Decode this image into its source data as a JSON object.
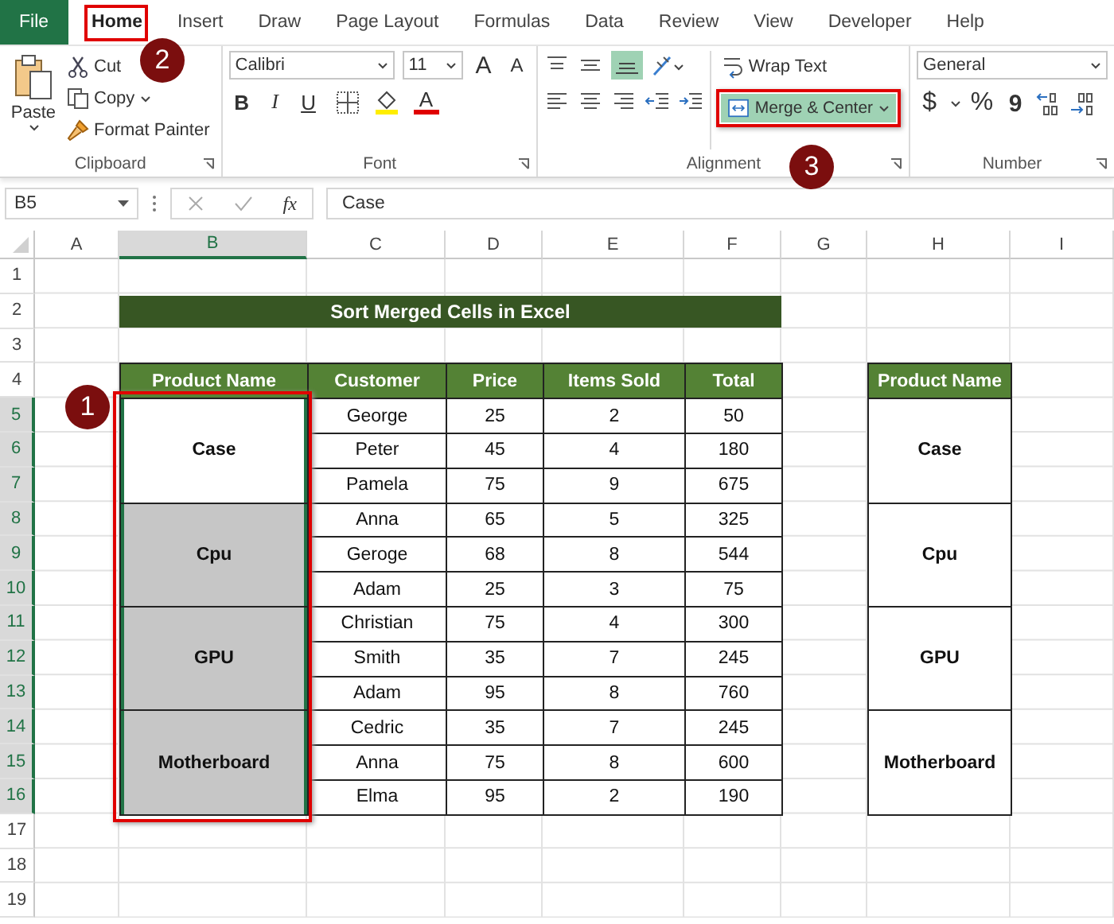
{
  "tabs": [
    {
      "label": "File",
      "kind": "file",
      "selected": false
    },
    {
      "label": "Home",
      "kind": "tab",
      "selected": true
    },
    {
      "label": "Insert",
      "kind": "tab",
      "selected": false
    },
    {
      "label": "Draw",
      "kind": "tab",
      "selected": false
    },
    {
      "label": "Page Layout",
      "kind": "tab",
      "selected": false
    },
    {
      "label": "Formulas",
      "kind": "tab",
      "selected": false
    },
    {
      "label": "Data",
      "kind": "tab",
      "selected": false
    },
    {
      "label": "Review",
      "kind": "tab",
      "selected": false
    },
    {
      "label": "View",
      "kind": "tab",
      "selected": false
    },
    {
      "label": "Developer",
      "kind": "tab",
      "selected": false
    },
    {
      "label": "Help",
      "kind": "tab",
      "selected": false
    }
  ],
  "clipboard": {
    "paste": "Paste",
    "cut": "Cut",
    "copy": "Copy",
    "format_painter": "Format Painter",
    "label": "Clipboard"
  },
  "font": {
    "name": "Calibri",
    "size": "11",
    "grow": "A",
    "shrink": "A",
    "bold": "B",
    "italic": "I",
    "underline": "U",
    "color_button": "A",
    "label": "Font"
  },
  "alignment": {
    "wrap_text": "Wrap Text",
    "merge_center": {
      "label": "Merge & Center",
      "selected": true
    },
    "label": "Alignment"
  },
  "number": {
    "format": "General",
    "currency": "$",
    "percent": "%",
    "comma": "9",
    "label": "Number"
  },
  "formula_bar": {
    "name_box": "B5",
    "fx": "fx",
    "formula": "Case"
  },
  "columns": [
    {
      "label": "A",
      "selected": false
    },
    {
      "label": "B",
      "selected": true
    },
    {
      "label": "C",
      "selected": false
    },
    {
      "label": "D",
      "selected": false
    },
    {
      "label": "E",
      "selected": false
    },
    {
      "label": "F",
      "selected": false
    },
    {
      "label": "G",
      "selected": false
    },
    {
      "label": "H",
      "selected": false
    },
    {
      "label": "I",
      "selected": false
    }
  ],
  "rows": [
    {
      "label": "1",
      "selected": false
    },
    {
      "label": "2",
      "selected": false
    },
    {
      "label": "3",
      "selected": false
    },
    {
      "label": "4",
      "selected": false
    },
    {
      "label": "5",
      "selected": true
    },
    {
      "label": "6",
      "selected": true
    },
    {
      "label": "7",
      "selected": true
    },
    {
      "label": "8",
      "selected": true
    },
    {
      "label": "9",
      "selected": true
    },
    {
      "label": "10",
      "selected": true
    },
    {
      "label": "11",
      "selected": true
    },
    {
      "label": "12",
      "selected": true
    },
    {
      "label": "13",
      "selected": true
    },
    {
      "label": "14",
      "selected": true
    },
    {
      "label": "15",
      "selected": true
    },
    {
      "label": "16",
      "selected": true
    },
    {
      "label": "17",
      "selected": false
    },
    {
      "label": "18",
      "selected": false
    },
    {
      "label": "19",
      "selected": false
    }
  ],
  "title": "Sort Merged Cells in Excel",
  "table": {
    "headers": [
      "Product Name",
      "Customer",
      "Price",
      "Items Sold",
      "Total"
    ],
    "groups": [
      {
        "product": "Case",
        "selected": true,
        "active": true,
        "rows": [
          [
            "George",
            "25",
            "2",
            "50"
          ],
          [
            "Peter",
            "45",
            "4",
            "180"
          ],
          [
            "Pamela",
            "75",
            "9",
            "675"
          ]
        ]
      },
      {
        "product": "Cpu",
        "selected": true,
        "active": false,
        "rows": [
          [
            "Anna",
            "65",
            "5",
            "325"
          ],
          [
            "Geroge",
            "68",
            "8",
            "544"
          ],
          [
            "Adam",
            "25",
            "3",
            "75"
          ]
        ]
      },
      {
        "product": "GPU",
        "selected": true,
        "active": false,
        "rows": [
          [
            "Christian",
            "75",
            "4",
            "300"
          ],
          [
            "Smith",
            "35",
            "7",
            "245"
          ],
          [
            "Adam",
            "95",
            "8",
            "760"
          ]
        ]
      },
      {
        "product": "Motherboard",
        "selected": true,
        "active": false,
        "rows": [
          [
            "Cedric",
            "35",
            "7",
            "245"
          ],
          [
            "Anna",
            "75",
            "8",
            "600"
          ],
          [
            "Elma",
            "95",
            "2",
            "190"
          ]
        ]
      }
    ]
  },
  "side_table": {
    "header": "Product Name",
    "products": [
      "Case",
      "Cpu",
      "GPU",
      "Motherboard"
    ]
  },
  "annotations": [
    {
      "number": "1"
    },
    {
      "number": "2"
    },
    {
      "number": "3"
    }
  ]
}
